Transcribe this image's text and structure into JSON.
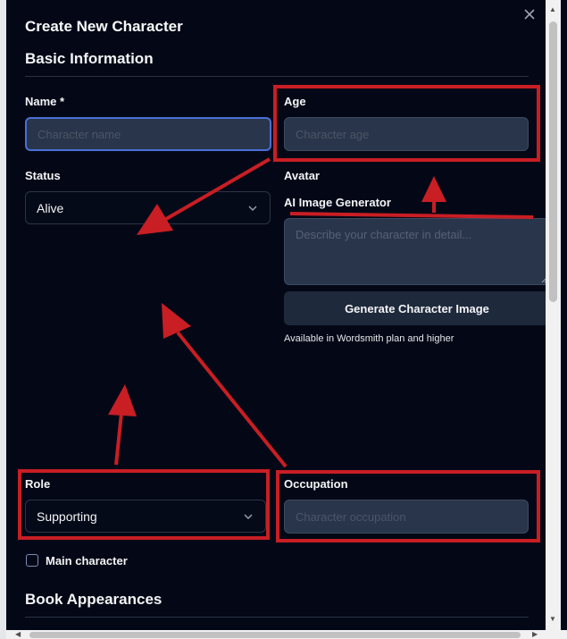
{
  "dialog": {
    "title": "Create New Character",
    "close_icon": "close-icon"
  },
  "basic_info": {
    "heading": "Basic Information",
    "name": {
      "label": "Name *",
      "placeholder": "Character name",
      "value": ""
    },
    "age": {
      "label": "Age",
      "placeholder": "Character age",
      "value": ""
    },
    "status": {
      "label": "Status",
      "value": "Alive"
    },
    "avatar": {
      "label": "Avatar",
      "generator_label": "AI Image Generator",
      "prompt_placeholder": "Describe your character in detail...",
      "generate_button": "Generate Character Image",
      "plan_hint": "Available in Wordsmith plan and higher"
    },
    "role": {
      "label": "Role",
      "value": "Supporting"
    },
    "occupation": {
      "label": "Occupation",
      "placeholder": "Character occupation",
      "value": ""
    },
    "main_character": {
      "label": "Main character",
      "checked": false
    }
  },
  "book_appearances": {
    "heading": "Book Appearances"
  },
  "colors": {
    "background": "#040816",
    "input_fill": "#29354a",
    "focus_ring": "#4a6fd8",
    "annotation_red": "#c81e24"
  }
}
